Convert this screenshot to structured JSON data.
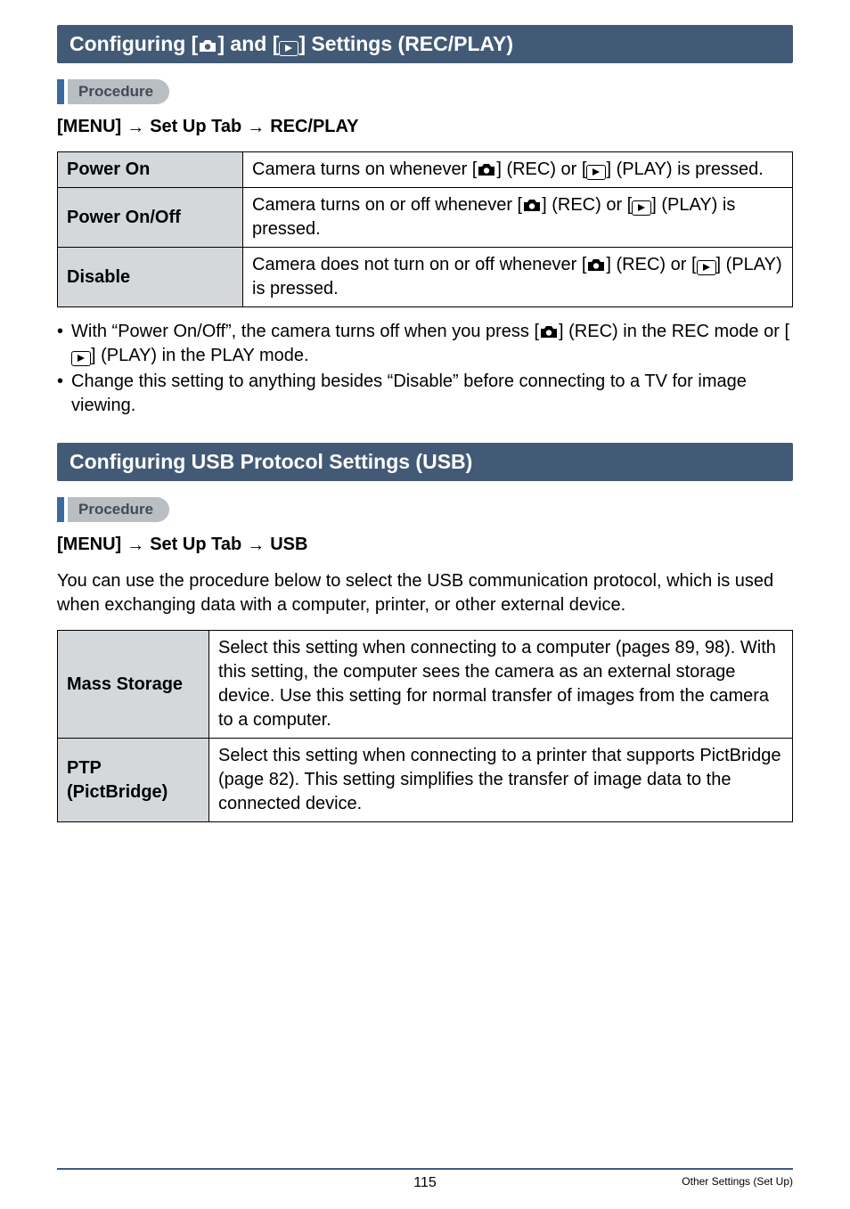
{
  "section1": {
    "title_parts": [
      "Configuring [",
      "] and [",
      "] Settings (REC/PLAY)"
    ],
    "procedure_label": "Procedure",
    "menu_path": {
      "menu": "[MENU]",
      "tab": "Set Up Tab",
      "item": "REC/PLAY"
    },
    "rows": [
      {
        "label": "Power On",
        "desc_parts": [
          "Camera turns on whenever [",
          "] (REC) or [",
          "] (PLAY) is pressed."
        ]
      },
      {
        "label": "Power On/Off",
        "desc_parts": [
          "Camera turns on or off whenever [",
          "] (REC) or [",
          "] (PLAY) is pressed."
        ]
      },
      {
        "label": "Disable",
        "desc_parts": [
          "Camera does not turn on or off whenever [",
          "] (REC) or [",
          "] (PLAY) is pressed."
        ]
      }
    ],
    "notes": [
      {
        "parts": [
          "With “Power On/Off”, the camera turns off when you press [",
          "] (REC) in the REC mode or [",
          "] (PLAY) in the PLAY mode."
        ]
      },
      {
        "parts": [
          "Change this setting to anything besides “Disable” before connecting to a TV for image viewing."
        ]
      }
    ]
  },
  "section2": {
    "title": "Configuring USB Protocol Settings (USB)",
    "procedure_label": "Procedure",
    "menu_path": {
      "menu": "[MENU]",
      "tab": "Set Up Tab",
      "item": "USB"
    },
    "intro": "You can use the procedure below to select the USB communication protocol, which is used when exchanging data with a computer, printer, or other external device.",
    "rows": [
      {
        "label": "Mass Storage",
        "desc": "Select this setting when connecting to a computer (pages 89, 98). With this setting, the computer sees the camera as an external storage device. Use this setting for normal transfer of images from the camera to a computer."
      },
      {
        "label": "PTP (PictBridge)",
        "desc": "Select this setting when connecting to a printer that supports PictBridge (page 82). This setting simplifies the transfer of image data to the connected device."
      }
    ]
  },
  "footer": {
    "page": "115",
    "section": "Other Settings (Set Up)"
  }
}
